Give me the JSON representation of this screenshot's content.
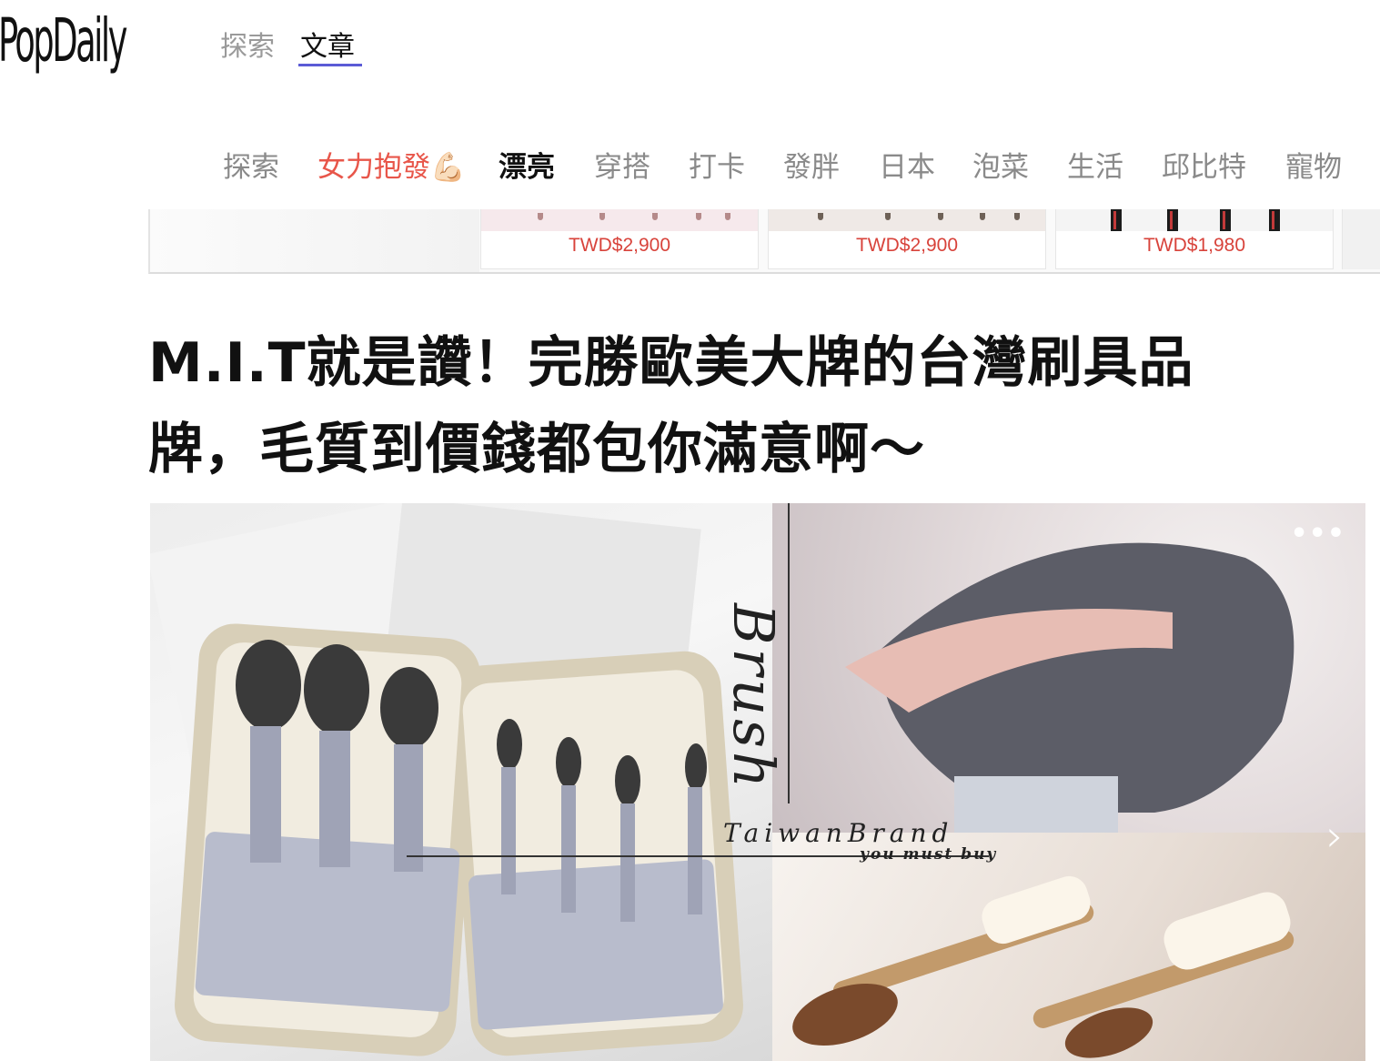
{
  "header": {
    "logo": "PopDaily",
    "tabs": [
      {
        "label": "探索"
      },
      {
        "label": "文章"
      }
    ]
  },
  "category_nav": {
    "items": [
      {
        "label": "探索"
      },
      {
        "label": "女力抱發💪🏻"
      },
      {
        "label": "漂亮"
      },
      {
        "label": "穿搭"
      },
      {
        "label": "打卡"
      },
      {
        "label": "發胖"
      },
      {
        "label": "日本"
      },
      {
        "label": "泡菜"
      },
      {
        "label": "生活"
      },
      {
        "label": "邱比特"
      },
      {
        "label": "寵物"
      }
    ],
    "active": "漂亮"
  },
  "product_strip": {
    "cards": [
      {
        "price": "TWD$2,900"
      },
      {
        "price": "TWD$2,900"
      },
      {
        "price": "TWD$1,980"
      }
    ]
  },
  "article": {
    "title": "M.I.T就是讚！完勝歐美大牌的台灣刷具品牌，毛質到價錢都包你滿意啊～"
  },
  "hero": {
    "overlay_word": "Brush",
    "brand_title": "TaiwanBrand",
    "brand_subtitle": "you must buy",
    "more_label": "•••",
    "next_label": "›"
  },
  "colors": {
    "accent": "#5b5bd6",
    "hot_category": "#e8564a",
    "price": "#d8433b"
  }
}
